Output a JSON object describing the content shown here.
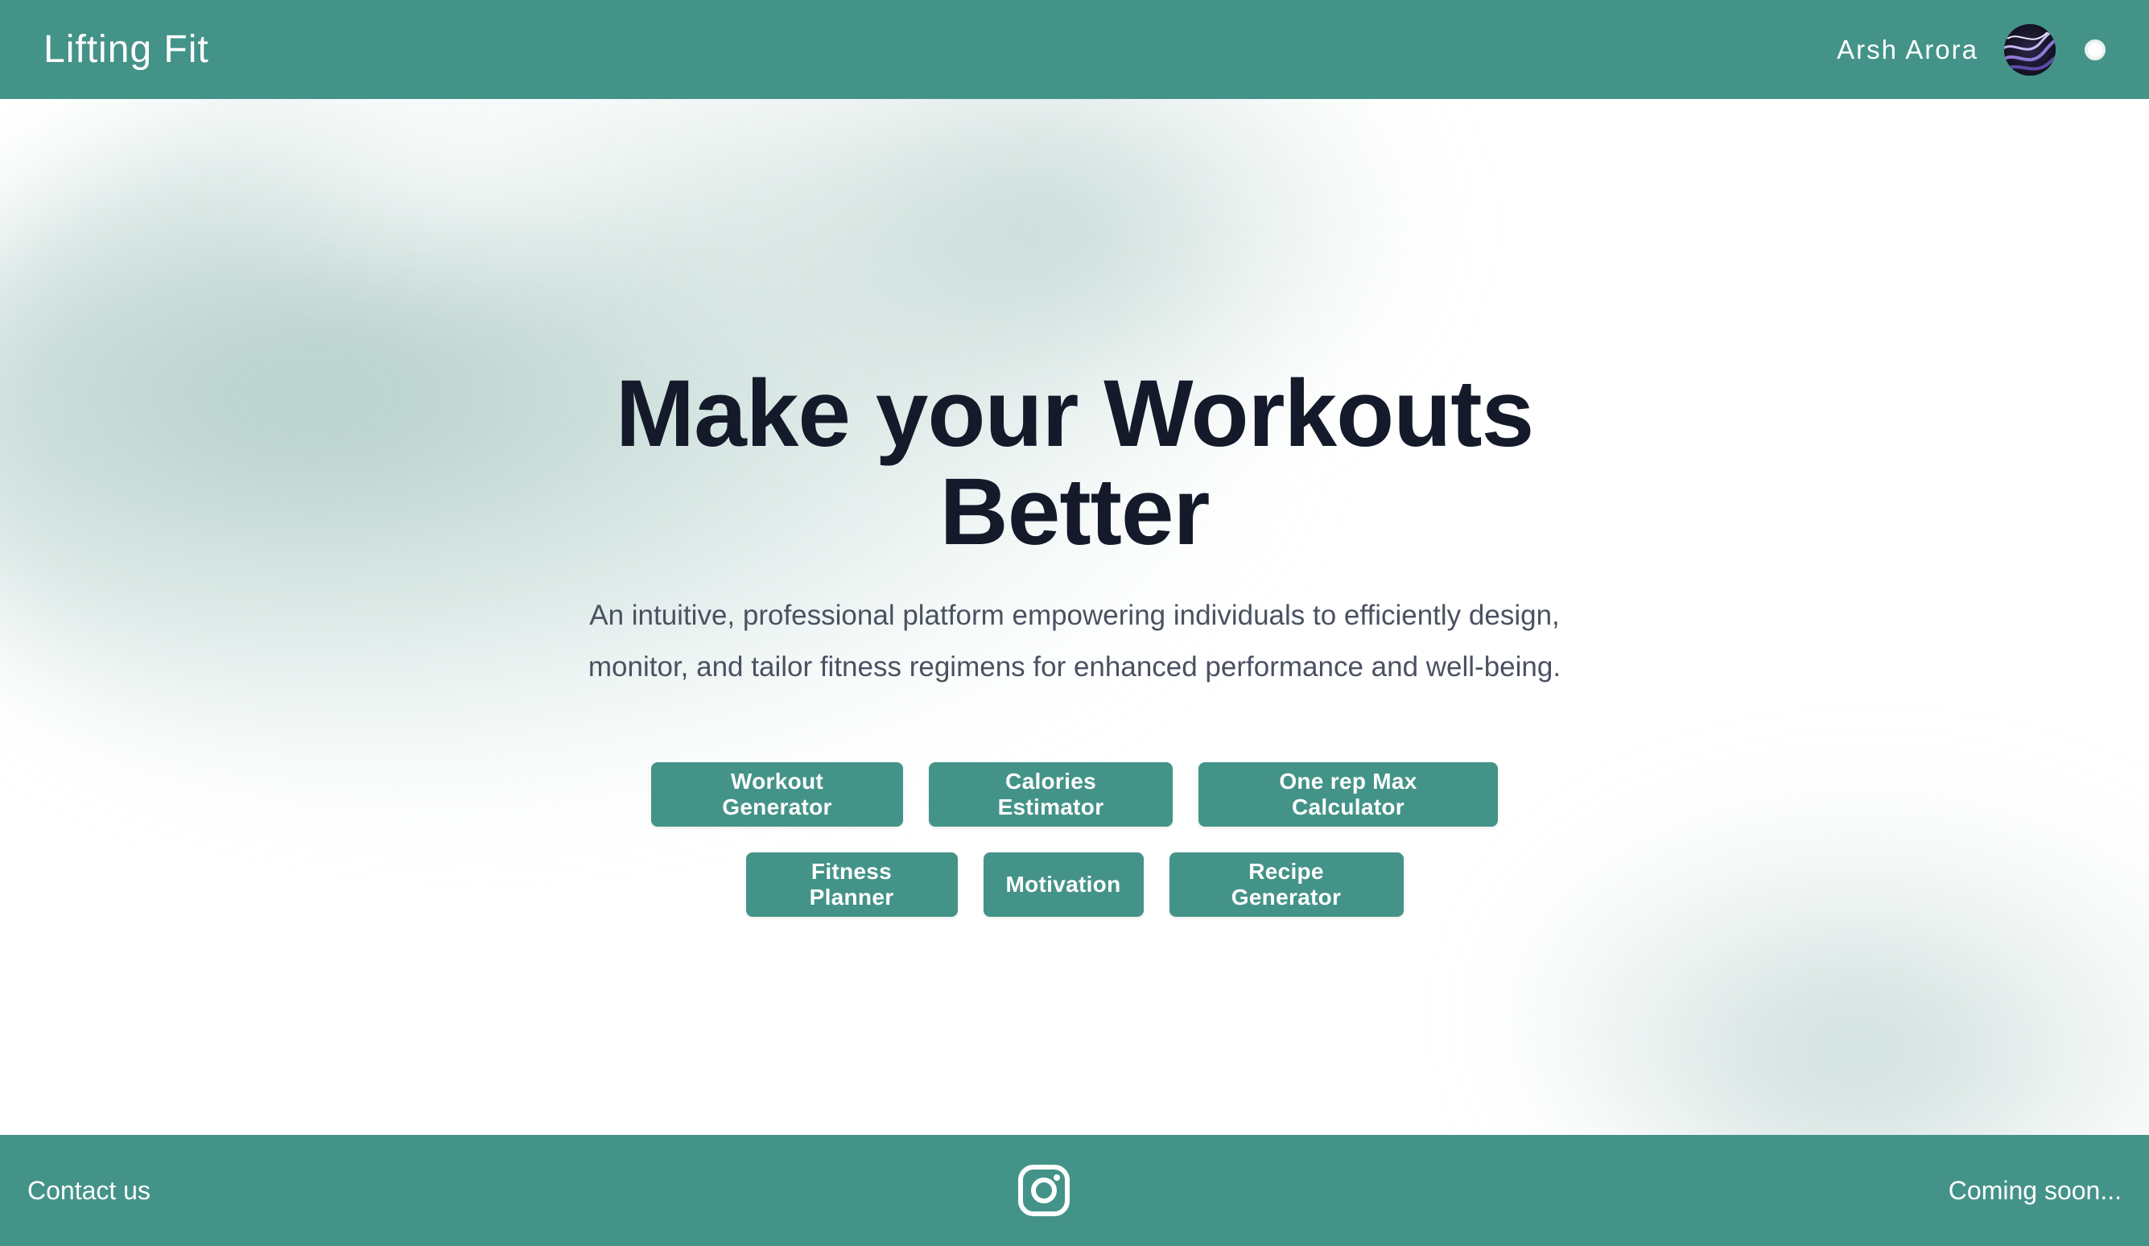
{
  "header": {
    "brand": "Lifting Fit",
    "user_name": "Arsh Arora",
    "avatar_icon": "abstract-swirl-avatar",
    "theme_toggle_icon": "circle-toggle-icon"
  },
  "hero": {
    "title": "Make your Workouts Better",
    "subtitle": "An intuitive, professional platform empowering individuals to efficiently design, monitor, and tailor fitness regimens for enhanced performance and well-being."
  },
  "buttons": {
    "row1": [
      "Workout Generator",
      "Calories Estimator",
      "One rep Max Calculator"
    ],
    "row2": [
      "Fitness Planner",
      "Motivation",
      "Recipe Generator"
    ]
  },
  "footer": {
    "contact": "Contact us",
    "social_icon": "instagram-icon",
    "coming_soon": "Coming soon..."
  },
  "colors": {
    "brand_teal": "#449388",
    "heading": "#141a2a",
    "body_text": "#4a5160",
    "background": "#ffffff"
  }
}
